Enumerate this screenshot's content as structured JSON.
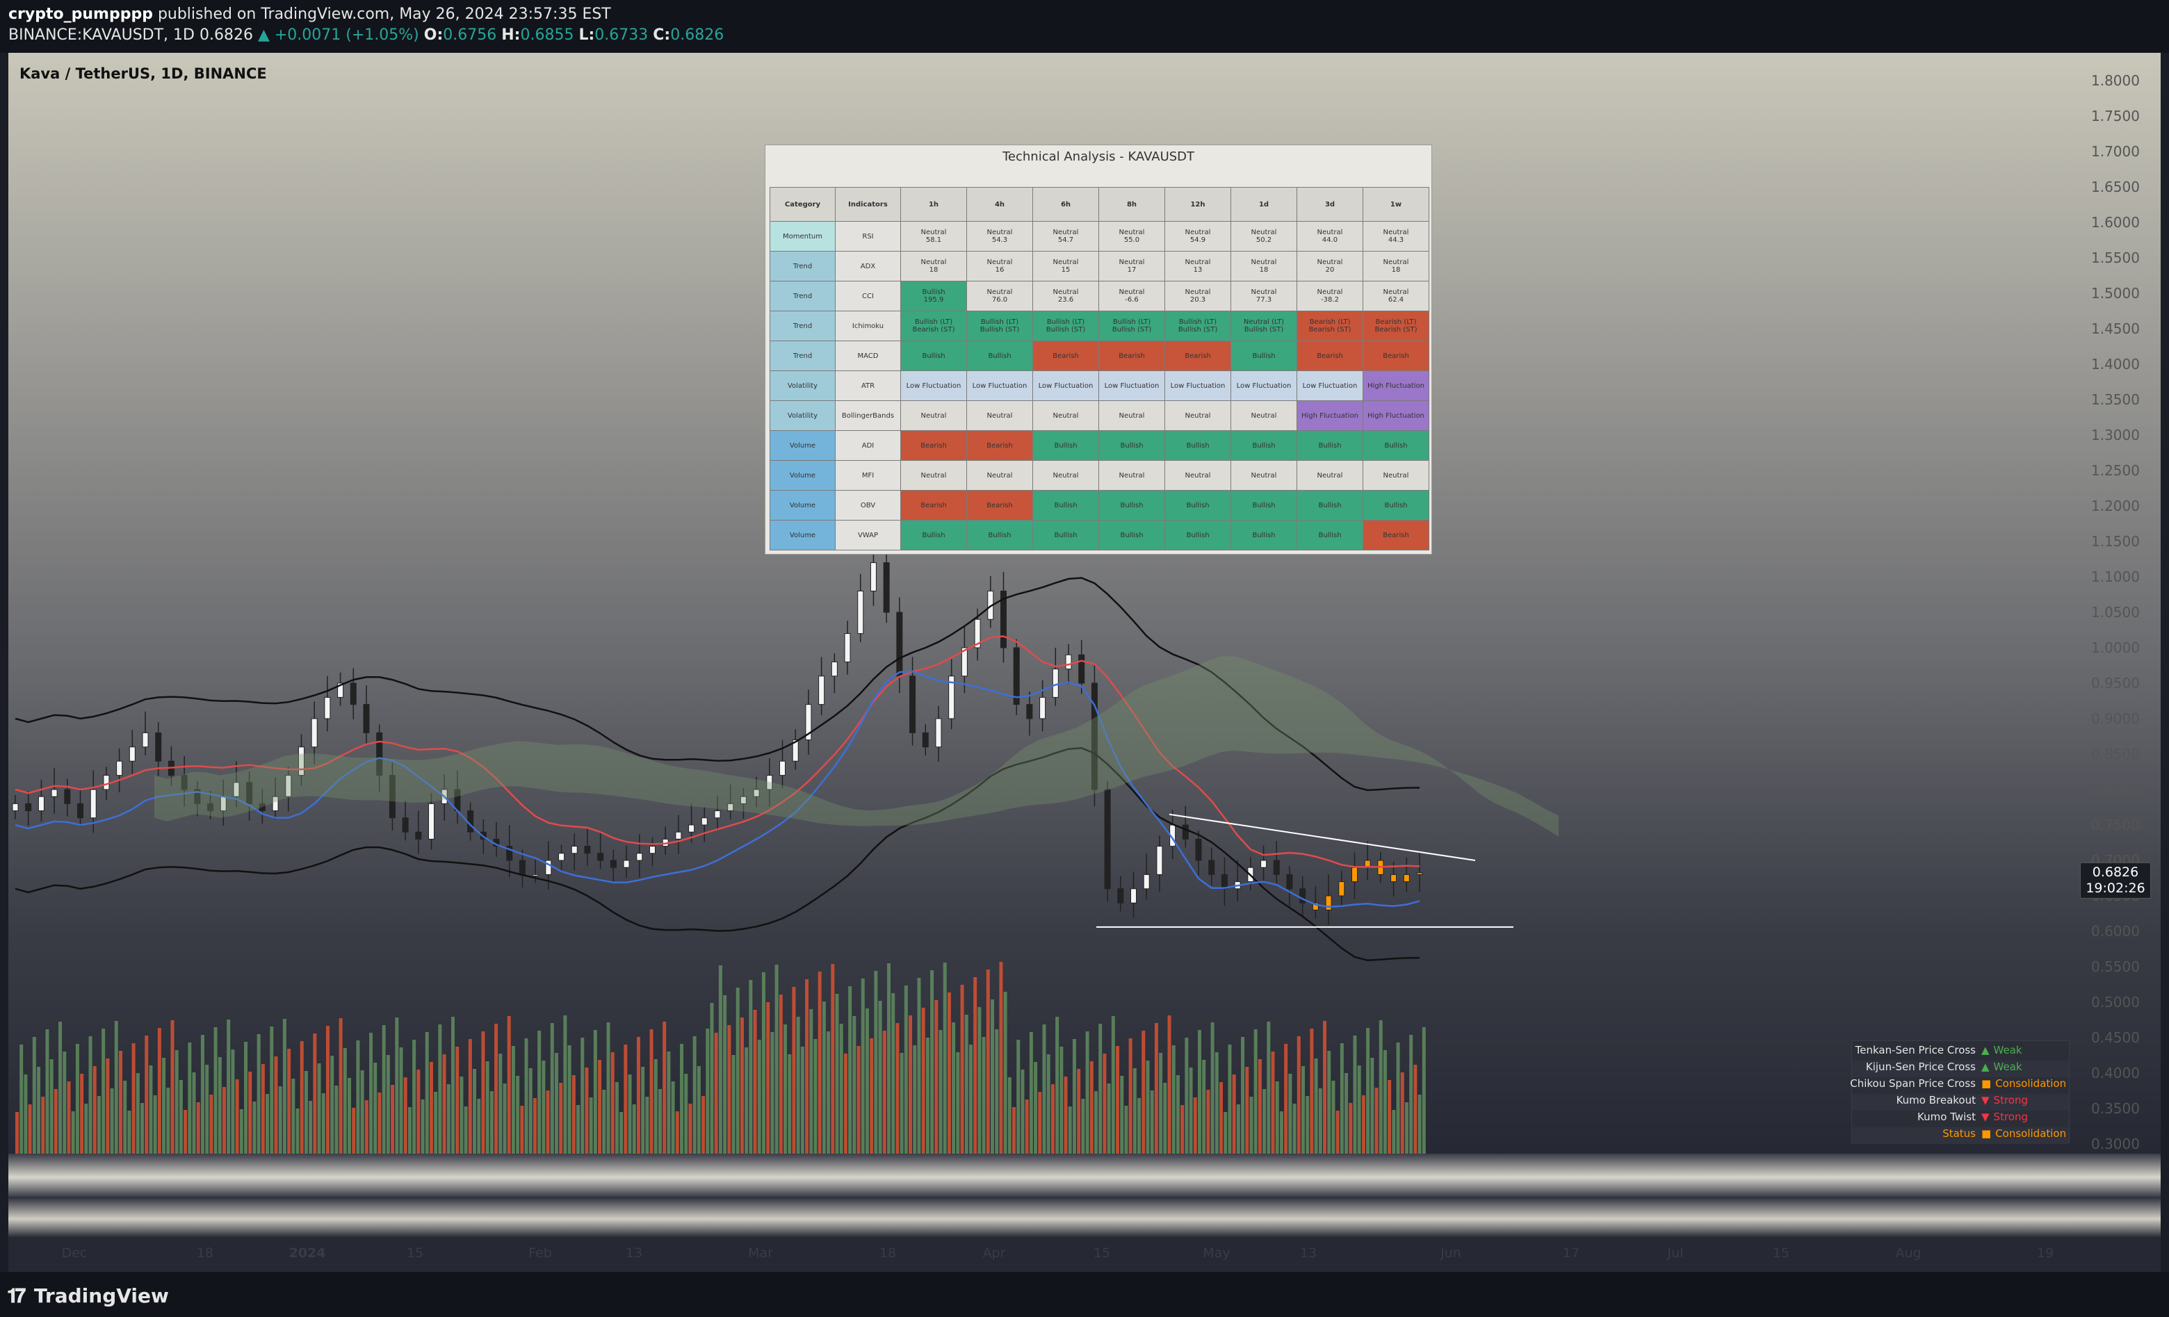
{
  "header": {
    "author": "crypto_pumpppp",
    "published_text": "published on TradingView.com, May 26, 2024 23:57:35 EST",
    "symbol": "BINANCE:KAVAUSDT, 1D",
    "last": "0.6826",
    "change": "+0.0071 (+1.05%)",
    "o_label": "O:",
    "o": "0.6756",
    "h_label": "H:",
    "h": "0.6855",
    "l_label": "L:",
    "l": "0.6733",
    "c_label": "C:",
    "c": "0.6826"
  },
  "chart_title": "Kava / TetherUS, 1D, BINANCE",
  "price_badge": {
    "price": "0.6826",
    "countdown": "19:02:26"
  },
  "footer": {
    "brand": "TradingView"
  },
  "x_axis_labels": [
    "Dec",
    "18",
    "2024",
    "15",
    "Feb",
    "13",
    "Mar",
    "18",
    "Apr",
    "15",
    "May",
    "13",
    "Jun",
    "17",
    "Jul",
    "15",
    "Aug",
    "19"
  ],
  "y_axis_labels": [
    "1.8000",
    "1.7500",
    "1.7000",
    "1.6500",
    "1.6000",
    "1.5500",
    "1.5000",
    "1.4500",
    "1.4000",
    "1.3500",
    "1.3000",
    "1.2500",
    "1.2000",
    "1.1500",
    "1.1000",
    "1.0500",
    "1.0000",
    "0.9500",
    "0.9000",
    "0.8500",
    "0.8000",
    "0.7500",
    "0.7000",
    "0.6500",
    "0.6000",
    "0.5500",
    "0.5000",
    "0.4500",
    "0.4000",
    "0.3500",
    "0.3000"
  ],
  "table": {
    "title": "Technical Analysis - KAVAUSDT",
    "headers": [
      "Category",
      "Indicators",
      "1h",
      "4h",
      "6h",
      "8h",
      "12h",
      "1d",
      "3d",
      "1w"
    ],
    "rows": [
      {
        "category": "Momentum",
        "indicator": "RSI",
        "cells": [
          [
            "Neutral",
            "58.1"
          ],
          [
            "Neutral",
            "54.3"
          ],
          [
            "Neutral",
            "54.7"
          ],
          [
            "Neutral",
            "55.0"
          ],
          [
            "Neutral",
            "54.9"
          ],
          [
            "Neutral",
            "50.2"
          ],
          [
            "Neutral",
            "44.0"
          ],
          [
            "Neutral",
            "44.3"
          ]
        ],
        "states": [
          "neutral",
          "neutral",
          "neutral",
          "neutral",
          "neutral",
          "neutral",
          "neutral",
          "neutral"
        ]
      },
      {
        "category": "Trend",
        "indicator": "ADX",
        "cells": [
          [
            "Neutral",
            "18"
          ],
          [
            "Neutral",
            "16"
          ],
          [
            "Neutral",
            "15"
          ],
          [
            "Neutral",
            "17"
          ],
          [
            "Neutral",
            "13"
          ],
          [
            "Neutral",
            "18"
          ],
          [
            "Neutral",
            "20"
          ],
          [
            "Neutral",
            "18"
          ]
        ],
        "states": [
          "neutral",
          "neutral",
          "neutral",
          "neutral",
          "neutral",
          "neutral",
          "neutral",
          "neutral"
        ]
      },
      {
        "category": "Trend",
        "indicator": "CCI",
        "cells": [
          [
            "Bullish",
            "195.9"
          ],
          [
            "Neutral",
            "76.0"
          ],
          [
            "Neutral",
            "23.6"
          ],
          [
            "Neutral",
            "-6.6"
          ],
          [
            "Neutral",
            "20.3"
          ],
          [
            "Neutral",
            "77.3"
          ],
          [
            "Neutral",
            "-38.2"
          ],
          [
            "Neutral",
            "62.4"
          ]
        ],
        "states": [
          "bullish",
          "neutral",
          "neutral",
          "neutral",
          "neutral",
          "neutral",
          "neutral",
          "neutral"
        ]
      },
      {
        "category": "Trend",
        "indicator": "Ichimoku",
        "cells": [
          [
            "Bullish (LT)",
            "Bearish (ST)"
          ],
          [
            "Bullish (LT)",
            "Bullish (ST)"
          ],
          [
            "Bullish (LT)",
            "Bullish (ST)"
          ],
          [
            "Bullish (LT)",
            "Bullish (ST)"
          ],
          [
            "Bullish (LT)",
            "Bullish (ST)"
          ],
          [
            "Neutral (LT)",
            "Bullish (ST)"
          ],
          [
            "Bearish (LT)",
            "Bearish (ST)"
          ],
          [
            "Bearish (LT)",
            "Bearish (ST)"
          ]
        ],
        "states": [
          "bullish",
          "bullish",
          "bullish",
          "bullish",
          "bullish",
          "bullish",
          "bearish",
          "bearish"
        ]
      },
      {
        "category": "Trend",
        "indicator": "MACD",
        "cells": [
          [
            "Bullish"
          ],
          [
            "Bullish"
          ],
          [
            "Bearish"
          ],
          [
            "Bearish"
          ],
          [
            "Bearish"
          ],
          [
            "Bullish"
          ],
          [
            "Bearish"
          ],
          [
            "Bearish"
          ]
        ],
        "states": [
          "bullish",
          "bullish",
          "bearish",
          "bearish",
          "bearish",
          "bullish",
          "bearish",
          "bearish"
        ]
      },
      {
        "category": "Volatility",
        "indicator": "ATR",
        "cells": [
          [
            "Low Fluctuation"
          ],
          [
            "Low Fluctuation"
          ],
          [
            "Low Fluctuation"
          ],
          [
            "Low Fluctuation"
          ],
          [
            "Low Fluctuation"
          ],
          [
            "Low Fluctuation"
          ],
          [
            "Low Fluctuation"
          ],
          [
            "High Fluctuation"
          ]
        ],
        "states": [
          "low",
          "low",
          "low",
          "low",
          "low",
          "low",
          "low",
          "high"
        ]
      },
      {
        "category": "Volatility",
        "indicator": "BollingerBands",
        "cells": [
          [
            "Neutral"
          ],
          [
            "Neutral"
          ],
          [
            "Neutral"
          ],
          [
            "Neutral"
          ],
          [
            "Neutral"
          ],
          [
            "Neutral"
          ],
          [
            "High Fluctuation"
          ],
          [
            "High Fluctuation"
          ]
        ],
        "states": [
          "neutral",
          "neutral",
          "neutral",
          "neutral",
          "neutral",
          "neutral",
          "high",
          "high"
        ]
      },
      {
        "category": "Volume",
        "indicator": "ADI",
        "cells": [
          [
            "Bearish"
          ],
          [
            "Bearish"
          ],
          [
            "Bullish"
          ],
          [
            "Bullish"
          ],
          [
            "Bullish"
          ],
          [
            "Bullish"
          ],
          [
            "Bullish"
          ],
          [
            "Bullish"
          ]
        ],
        "states": [
          "bearish",
          "bearish",
          "bullish",
          "bullish",
          "bullish",
          "bullish",
          "bullish",
          "bullish"
        ]
      },
      {
        "category": "Volume",
        "indicator": "MFI",
        "cells": [
          [
            "Neutral"
          ],
          [
            "Neutral"
          ],
          [
            "Neutral"
          ],
          [
            "Neutral"
          ],
          [
            "Neutral"
          ],
          [
            "Neutral"
          ],
          [
            "Neutral"
          ],
          [
            "Neutral"
          ]
        ],
        "states": [
          "neutral",
          "neutral",
          "neutral",
          "neutral",
          "neutral",
          "neutral",
          "neutral",
          "neutral"
        ]
      },
      {
        "category": "Volume",
        "indicator": "OBV",
        "cells": [
          [
            "Bearish"
          ],
          [
            "Bearish"
          ],
          [
            "Bullish"
          ],
          [
            "Bullish"
          ],
          [
            "Bullish"
          ],
          [
            "Bullish"
          ],
          [
            "Bullish"
          ],
          [
            "Bullish"
          ]
        ],
        "states": [
          "bearish",
          "bearish",
          "bullish",
          "bullish",
          "bullish",
          "bullish",
          "bullish",
          "bullish"
        ]
      },
      {
        "category": "Volume",
        "indicator": "VWAP",
        "cells": [
          [
            "Bullish"
          ],
          [
            "Bullish"
          ],
          [
            "Bullish"
          ],
          [
            "Bullish"
          ],
          [
            "Bullish"
          ],
          [
            "Bullish"
          ],
          [
            "Bullish"
          ],
          [
            "Bearish"
          ]
        ],
        "states": [
          "bullish",
          "bullish",
          "bullish",
          "bullish",
          "bullish",
          "bullish",
          "bullish",
          "bearish"
        ]
      }
    ]
  },
  "ichimoku_status": [
    {
      "label": "Tenkan-Sen Price Cross",
      "symbol": "▲",
      "value": "Weak",
      "color": "#4caf50"
    },
    {
      "label": "Kijun-Sen Price Cross",
      "symbol": "▲",
      "value": "Weak",
      "color": "#4caf50"
    },
    {
      "label": "Chikou Span Price Cross",
      "symbol": "■",
      "value": "Consolidation",
      "color": "#ff9800"
    },
    {
      "label": "Kumo Breakout",
      "symbol": "▼",
      "value": "Strong",
      "color": "#f23645"
    },
    {
      "label": "Kumo Twist",
      "symbol": "▼",
      "value": "Strong",
      "color": "#f23645"
    },
    {
      "label": "Status",
      "symbol": "■",
      "value": "Consolidation",
      "color": "#ff9800",
      "label_color": "#ff9800"
    }
  ],
  "colors": {
    "up_text": "#26a69a",
    "bullish": "#3ba77f",
    "bearish": "#c8553a",
    "neutral": "#dedcd6",
    "low_fluctuation": "#c7d6e6",
    "high_fluctuation": "#9b77c9"
  },
  "chart_data": {
    "type": "candlestick",
    "title": "Kava / TetherUS, 1D, BINANCE",
    "symbol": "KAVAUSDT",
    "timeframe": "1D",
    "y_range": [
      0.3,
      1.8
    ],
    "y_ticks": [
      1.8,
      1.75,
      1.7,
      1.65,
      1.6,
      1.55,
      1.5,
      1.45,
      1.4,
      1.35,
      1.3,
      1.25,
      1.2,
      1.15,
      1.1,
      1.05,
      1.0,
      0.95,
      0.9,
      0.85,
      0.8,
      0.75,
      0.7,
      0.65,
      0.6,
      0.55,
      0.5,
      0.45,
      0.4,
      0.35,
      0.3
    ],
    "x_tick_labels": [
      "Dec",
      "18",
      "2024",
      "15",
      "Feb",
      "13",
      "Mar",
      "18",
      "Apr",
      "15",
      "May",
      "13",
      "Jun",
      "17",
      "Jul",
      "15",
      "Aug",
      "19"
    ],
    "last_price": 0.6826,
    "close_series_approx": [
      0.78,
      0.77,
      0.79,
      0.8,
      0.78,
      0.76,
      0.8,
      0.82,
      0.84,
      0.86,
      0.88,
      0.84,
      0.82,
      0.8,
      0.78,
      0.77,
      0.79,
      0.81,
      0.78,
      0.77,
      0.79,
      0.82,
      0.86,
      0.9,
      0.93,
      0.95,
      0.92,
      0.88,
      0.82,
      0.76,
      0.74,
      0.73,
      0.78,
      0.8,
      0.77,
      0.74,
      0.73,
      0.72,
      0.7,
      0.68,
      0.68,
      0.7,
      0.71,
      0.72,
      0.71,
      0.7,
      0.69,
      0.7,
      0.71,
      0.72,
      0.73,
      0.74,
      0.75,
      0.76,
      0.77,
      0.78,
      0.79,
      0.8,
      0.82,
      0.84,
      0.87,
      0.92,
      0.96,
      0.98,
      1.02,
      1.08,
      1.12,
      1.05,
      0.96,
      0.88,
      0.86,
      0.9,
      0.96,
      1.0,
      1.04,
      1.08,
      1.0,
      0.92,
      0.9,
      0.93,
      0.97,
      0.99,
      0.95,
      0.8,
      0.66,
      0.64,
      0.66,
      0.68,
      0.72,
      0.75,
      0.73,
      0.7,
      0.68,
      0.66,
      0.67,
      0.69,
      0.7,
      0.68,
      0.66,
      0.64,
      0.63,
      0.65,
      0.67,
      0.69,
      0.7,
      0.68,
      0.67,
      0.68,
      0.6826
    ]
  }
}
